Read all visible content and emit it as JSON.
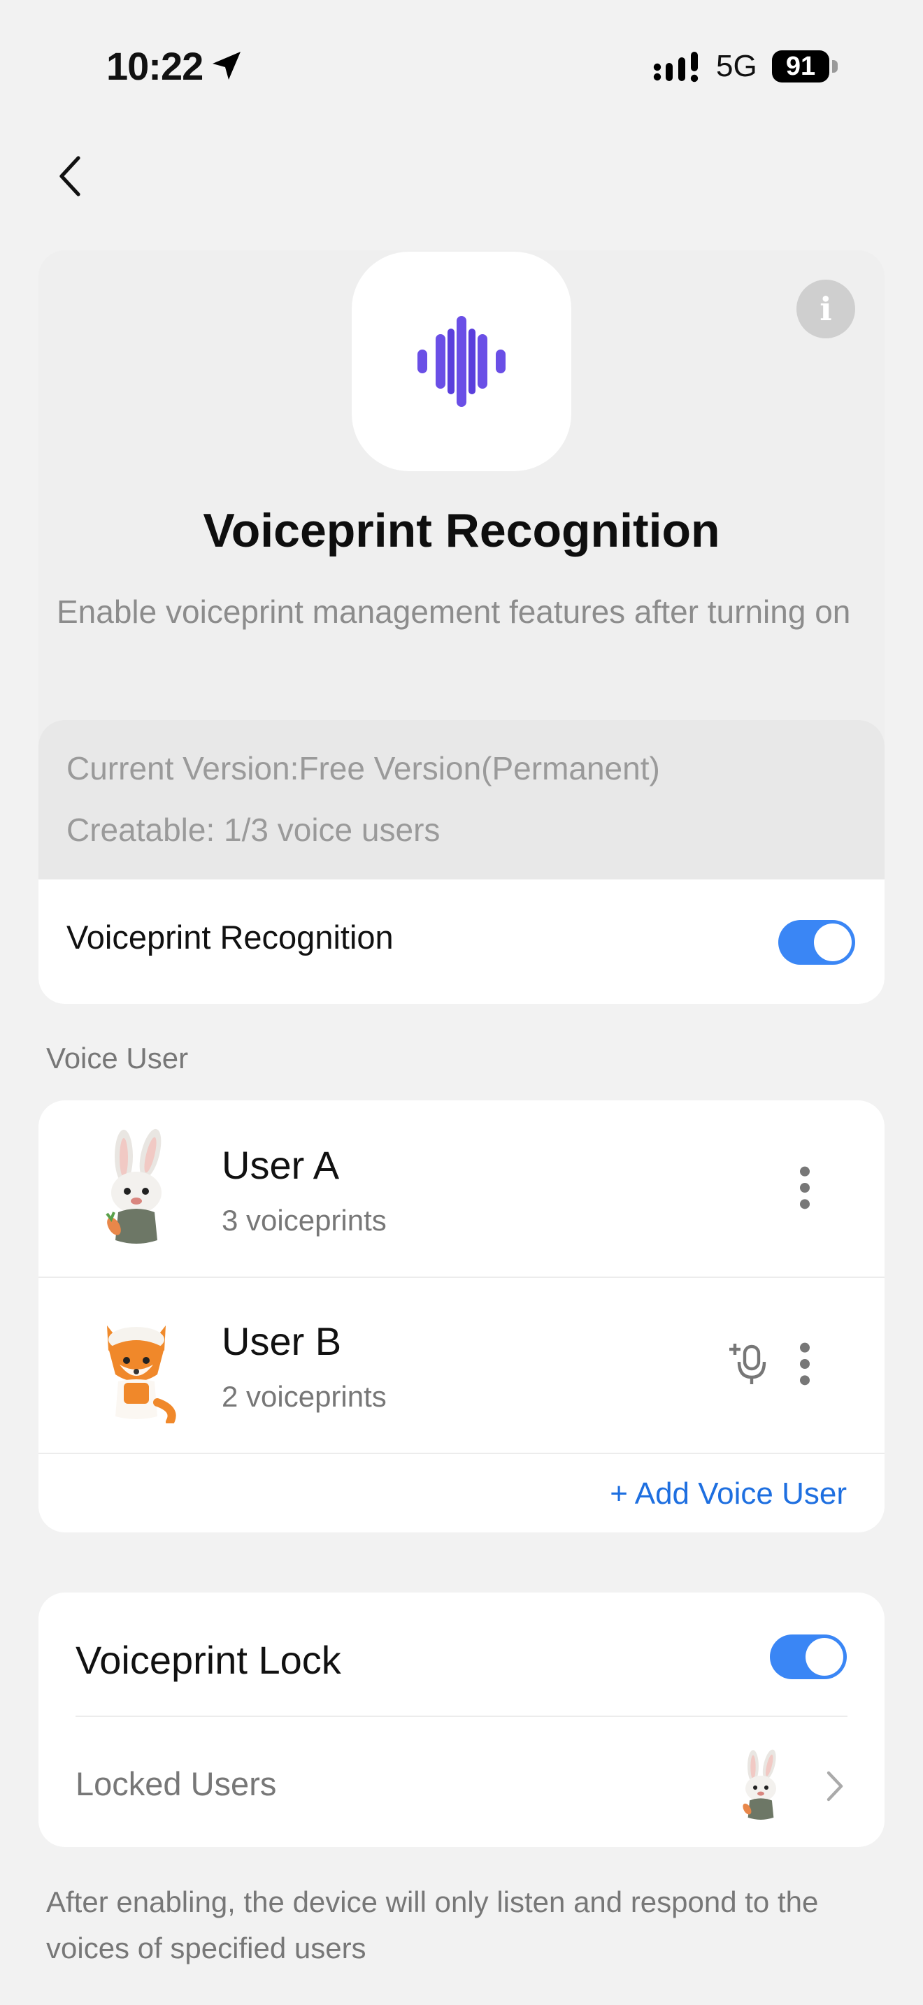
{
  "status_bar": {
    "time": "10:22",
    "network": "5G",
    "battery": "91"
  },
  "header": {
    "back_icon": "chevron-left-icon"
  },
  "hero": {
    "icon": "soundwave-icon",
    "title": "Voiceprint Recognition",
    "description": "Enable voiceprint management features after turning on",
    "version_line": "Current Version:Free Version(Permanent)",
    "creatable_line": "Creatable: 1/3 voice users",
    "toggle_label": "Voiceprint Recognition",
    "toggle_on": true,
    "accent": "#3a86f5",
    "wave_color": "#6a4fe6"
  },
  "voice_users": {
    "section_label": "Voice User",
    "users": [
      {
        "name": "User A",
        "sub": "3 voiceprints",
        "avatar": "rabbit-avatar"
      },
      {
        "name": "User B",
        "sub": "2 voiceprints",
        "avatar": "fox-avatar"
      }
    ],
    "add_label": "+ Add Voice User"
  },
  "lock": {
    "title": "Voiceprint Lock",
    "toggle_on": true,
    "locked_users_label": "Locked Users",
    "note": "After enabling, the device will only listen and respond to the voices of specified users"
  }
}
